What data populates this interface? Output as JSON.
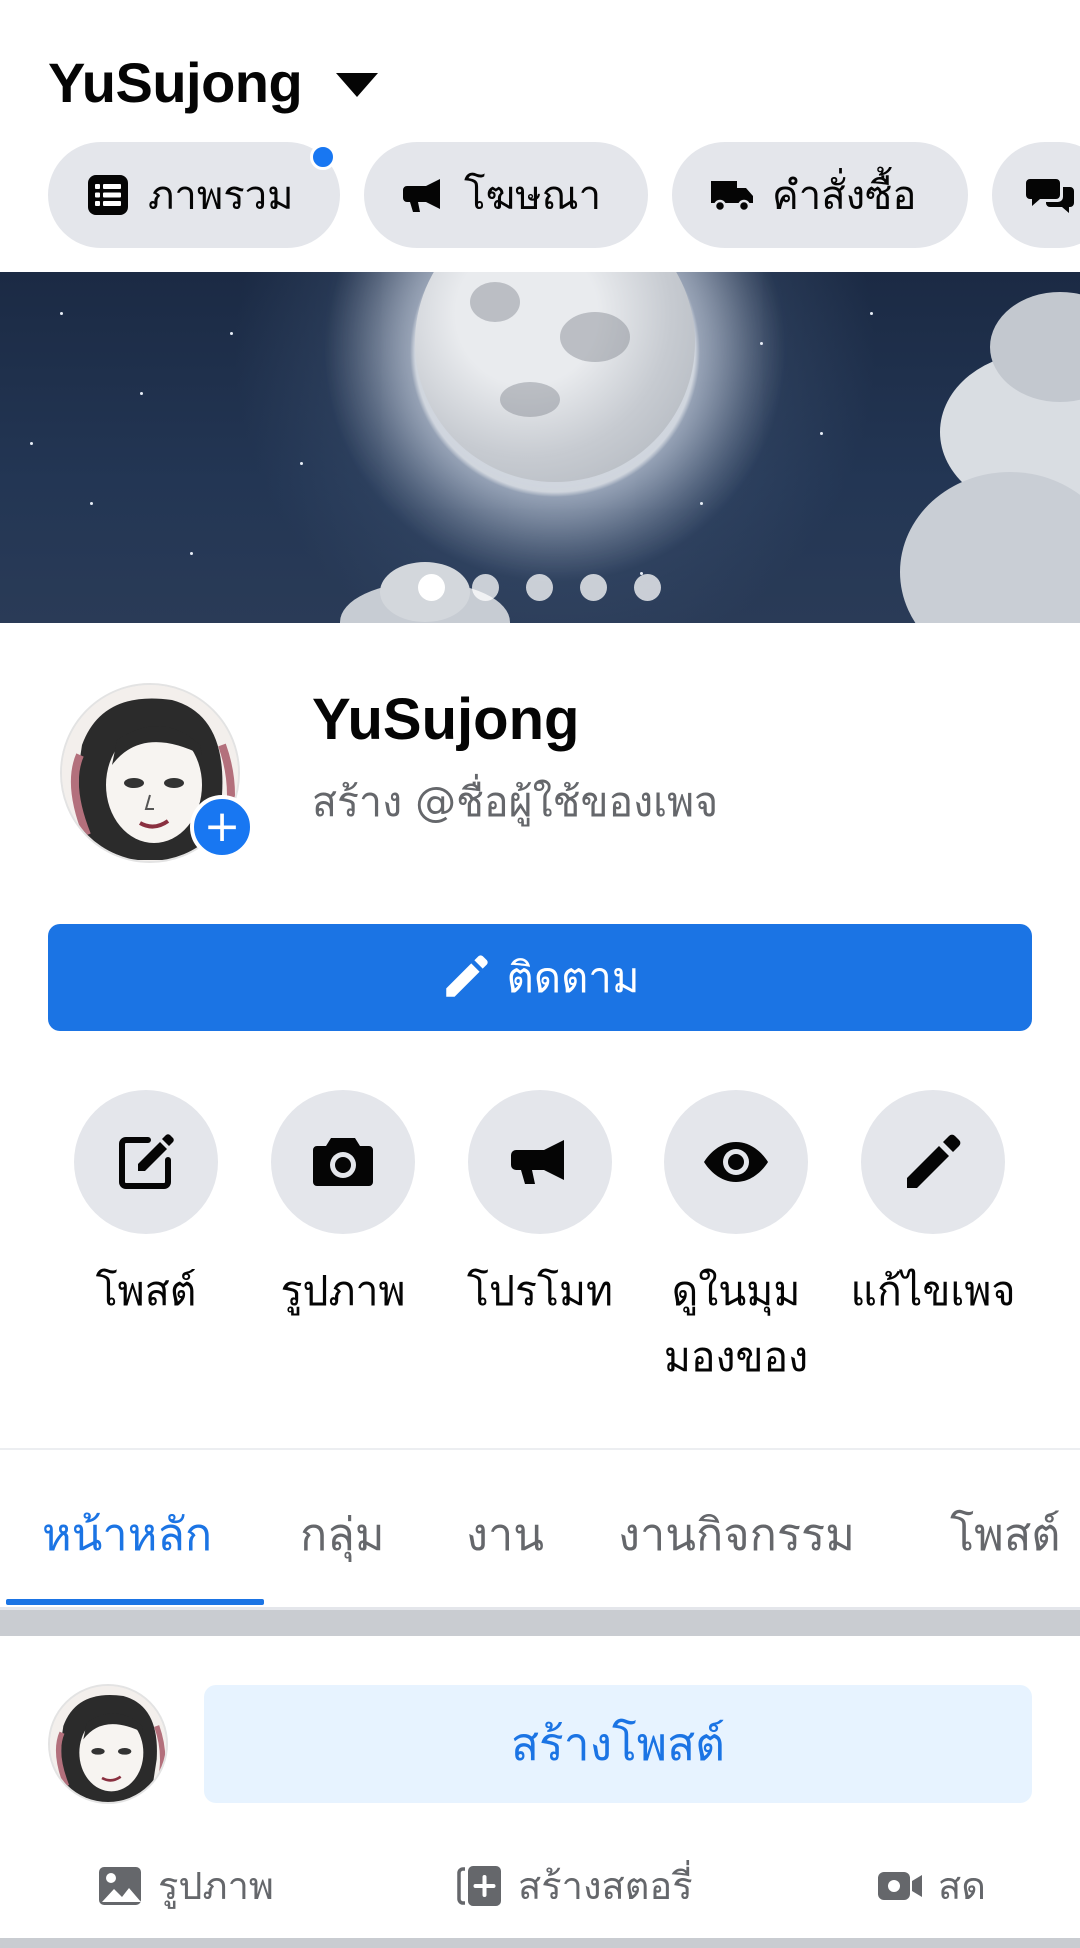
{
  "header": {
    "page_name": "YuSujong",
    "chips": [
      {
        "label": "ภาพรวม",
        "icon": "list-icon",
        "has_notification": true
      },
      {
        "label": "โฆษณา",
        "icon": "megaphone-icon",
        "has_notification": false
      },
      {
        "label": "คำสั่งซื้อ",
        "icon": "truck-icon",
        "has_notification": false
      },
      {
        "label": "",
        "icon": "chat-bubbles-icon",
        "has_notification": false
      }
    ]
  },
  "cover": {
    "slide_count": 5,
    "active_slide": 1
  },
  "profile": {
    "name": "YuSujong",
    "username_prompt": "สร้าง @ชื่อผู้ใช้ของเพจ"
  },
  "follow_button": {
    "label": "ติดตาม",
    "icon": "pencil-icon"
  },
  "actions": [
    {
      "label": "โพสต์",
      "icon": "edit-square-icon"
    },
    {
      "label": "รูปภาพ",
      "icon": "camera-icon"
    },
    {
      "label": "โปรโมท",
      "icon": "megaphone-icon"
    },
    {
      "label_line1": "ดูในมุม",
      "label_line2": "มองของ",
      "icon": "eye-icon"
    },
    {
      "label": "แก้ไขเพจ",
      "icon": "pencil-icon"
    }
  ],
  "tabs": [
    {
      "label": "หน้าหลัก",
      "active": true
    },
    {
      "label": "กลุ่ม",
      "active": false
    },
    {
      "label": "งาน",
      "active": false
    },
    {
      "label": "งานกิจกรรม",
      "active": false
    },
    {
      "label": "โพสต์",
      "active": false
    }
  ],
  "composer": {
    "create_post": "สร้างโพสต์",
    "quick_actions": [
      {
        "label": "รูปภาพ",
        "icon": "photo-icon"
      },
      {
        "label": "สร้างสตอรี่",
        "icon": "add-story-icon"
      },
      {
        "label": "สด",
        "icon": "live-video-icon"
      }
    ]
  },
  "colors": {
    "accent": "#1b74e4",
    "chip_bg": "#e4e6eb",
    "secondary_text": "#65676b",
    "notification_dot": "#1877f2"
  }
}
